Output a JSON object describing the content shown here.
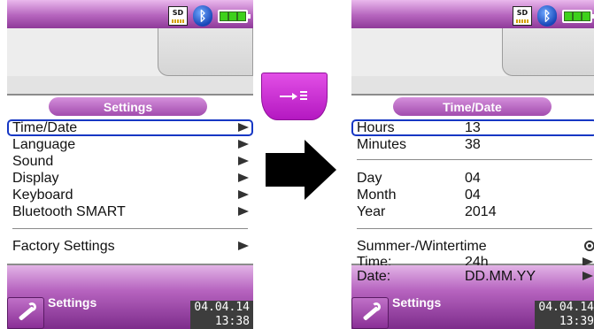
{
  "left_screen": {
    "panel_title": "Settings",
    "items": [
      {
        "label": "Time/Date"
      },
      {
        "label": "Language"
      },
      {
        "label": "Sound"
      },
      {
        "label": "Display"
      },
      {
        "label": "Keyboard"
      },
      {
        "label": "Bluetooth SMART"
      },
      {
        "label": "Factory Settings"
      }
    ],
    "bottom_label": "Settings",
    "date": "04.04.14",
    "time": "13:38"
  },
  "right_screen": {
    "panel_title": "Time/Date",
    "rows": [
      {
        "label": "Hours",
        "value": "13"
      },
      {
        "label": "Minutes",
        "value": "38"
      },
      {
        "label": "Day",
        "value": "04"
      },
      {
        "label": "Month",
        "value": "04"
      },
      {
        "label": "Year",
        "value": "2014"
      },
      {
        "label": "Summer-/Wintertime",
        "value": ""
      },
      {
        "label": "Time:",
        "value": "24h"
      },
      {
        "label": "Date:",
        "value": "DD.MM.YY"
      }
    ],
    "bottom_label": "Settings",
    "date": "04.04.14",
    "time": "13:39"
  },
  "status_icons": {
    "sd_label": "SD",
    "bluetooth_glyph": "ᛒ"
  },
  "icons": [
    "sd-card-icon",
    "bluetooth-icon",
    "battery-icon",
    "wrench-icon",
    "enter-key-icon",
    "arrow-right-icon",
    "radio-icon"
  ],
  "colors": {
    "accent": "#b564bd",
    "selection": "#1637c4",
    "key_button": "#d033d6"
  }
}
